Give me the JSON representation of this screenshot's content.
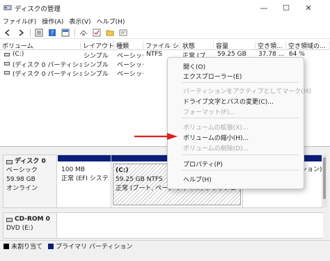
{
  "window": {
    "title": "ディスクの管理",
    "min": "—",
    "max": "☐",
    "close": "✕"
  },
  "menu": [
    "ファイル(F)",
    "操作(A)",
    "表示(V)",
    "ヘルプ(H)"
  ],
  "toolbar": [
    "back-arrow-icon",
    "forward-arrow-icon",
    "list-view-icon",
    "help-icon",
    "detail-view-icon",
    "connect-icon",
    "checkmark-icon",
    "folder-icon",
    "properties-icon"
  ],
  "volumes": {
    "headers": [
      "ボリューム",
      "レイアウト",
      "種類",
      "ファイル シ...",
      "状態",
      "容量",
      "空き領...",
      "空き領域の..."
    ],
    "rows": [
      [
        "(C:)",
        "シンプル",
        "ベーシック",
        "NTFS",
        "正常 (ブ...",
        "59.25 GB",
        "37.78 ...",
        "64 %"
      ],
      [
        "(ディスク 0 パーティション 1)",
        "シンプル",
        "ベーシック",
        "",
        "",
        "",
        "",
        ""
      ],
      [
        "(ディスク 0 パーティション 5)",
        "シンプル",
        "ベーシック",
        "",
        "",
        "",
        "",
        ""
      ]
    ]
  },
  "disks": [
    {
      "name": "ディスク 0",
      "type": "ベーシック",
      "size": "59.98 GB",
      "status": "オンライン",
      "partitions": [
        {
          "line1": "",
          "line2": "100 MB",
          "line3": "正常 (EFI システム"
        },
        {
          "line1": "(C:)",
          "line2": "59.25 GB NTFS",
          "line3": "正常 (ブート, ページ ファイル, クラッシュ ダンプ, ベーシ..."
        },
        {
          "line1": "",
          "line2": "",
          "line3": "正常 (回復パーティション)"
        }
      ]
    },
    {
      "name": "CD-ROM 0",
      "type": "DVD (E:)",
      "size": "",
      "status": "",
      "partitions": []
    }
  ],
  "legend": [
    {
      "label": "未割り当て",
      "color": "#000000"
    },
    {
      "label": "プライマリ パーティション",
      "color": "#0b1f7a"
    }
  ],
  "context_menu": {
    "items": [
      {
        "label": "開く(O)",
        "enabled": true
      },
      {
        "label": "エクスプローラー(E)",
        "enabled": true
      },
      {
        "label": "パーティションをアクティブとしてマーク(M)",
        "enabled": false
      },
      {
        "label": "ドライブ文字とパスの変更(C)...",
        "enabled": true
      },
      {
        "label": "フォーマット(F)...",
        "enabled": false
      },
      {
        "label": "ボリュームの拡張(X)...",
        "enabled": false
      },
      {
        "label": "ボリュームの縮小(H)...",
        "enabled": true
      },
      {
        "label": "ボリュームの削除(D)...",
        "enabled": false
      },
      {
        "label": "プロパティ(P)",
        "enabled": true
      },
      {
        "label": "ヘルプ(H)",
        "enabled": true
      }
    ]
  },
  "colors": {
    "accent_arrow": "#e0201c",
    "partition_bar": "#0b1f7a"
  }
}
